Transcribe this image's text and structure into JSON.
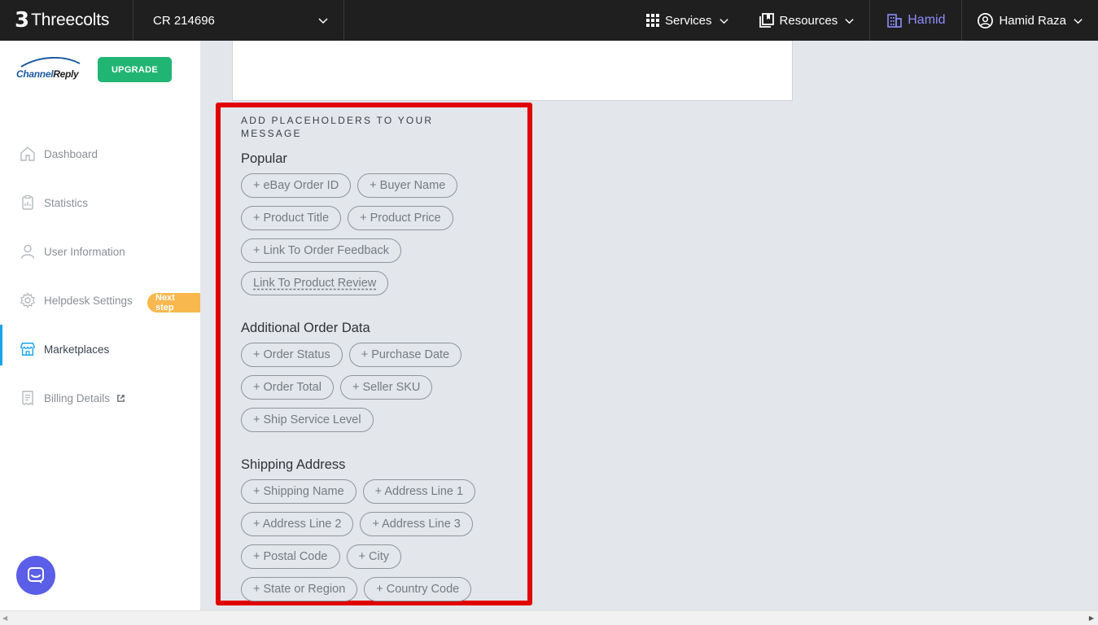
{
  "topbar": {
    "brand_mark": "3",
    "brand_name": "Threecolts",
    "account": "CR 214696",
    "services_label": "Services",
    "resources_label": "Resources",
    "org_label": "Hamid",
    "user_label": "Hamid Raza"
  },
  "sidebar": {
    "logo_channel": "Channel",
    "logo_reply": "Reply",
    "upgrade_label": "UPGRADE",
    "next_step_badge": "Next step",
    "items": [
      {
        "label": "Dashboard",
        "icon": "home-icon"
      },
      {
        "label": "Statistics",
        "icon": "clipboard-icon"
      },
      {
        "label": "User Information",
        "icon": "user-icon"
      },
      {
        "label": "Helpdesk Settings",
        "icon": "gear-icon"
      },
      {
        "label": "Marketplaces",
        "icon": "store-icon",
        "active": true
      },
      {
        "label": "Billing Details",
        "icon": "billing-icon"
      }
    ]
  },
  "placeholders": {
    "title": "ADD PLACEHOLDERS TO YOUR MESSAGE",
    "groups": [
      {
        "title": "Popular",
        "chips": [
          "+ eBay Order ID",
          "+ Buyer Name",
          "+ Product Title",
          "+ Product Price",
          "+ Link To Order Feedback",
          "Link To Product Review"
        ]
      },
      {
        "title": "Additional Order Data",
        "chips": [
          "+ Order Status",
          "+ Purchase Date",
          "+ Order Total",
          "+ Seller SKU",
          "+ Ship Service Level"
        ]
      },
      {
        "title": "Shipping Address",
        "chips": [
          "+ Shipping Name",
          "+ Address Line 1",
          "+ Address Line 2",
          "+ Address Line 3",
          "+ Postal Code",
          "+ City",
          "+ State or Region",
          "+ Country Code"
        ]
      }
    ]
  },
  "colors": {
    "topbar_bg": "#1f1f1f",
    "org_accent": "#8f8cff",
    "upgrade_green": "#21b573",
    "next_step_orange": "#f8b84e",
    "active_indicator": "#1aa3e8",
    "highlight_red": "#e00000",
    "chat_button": "#5b5ee6"
  }
}
